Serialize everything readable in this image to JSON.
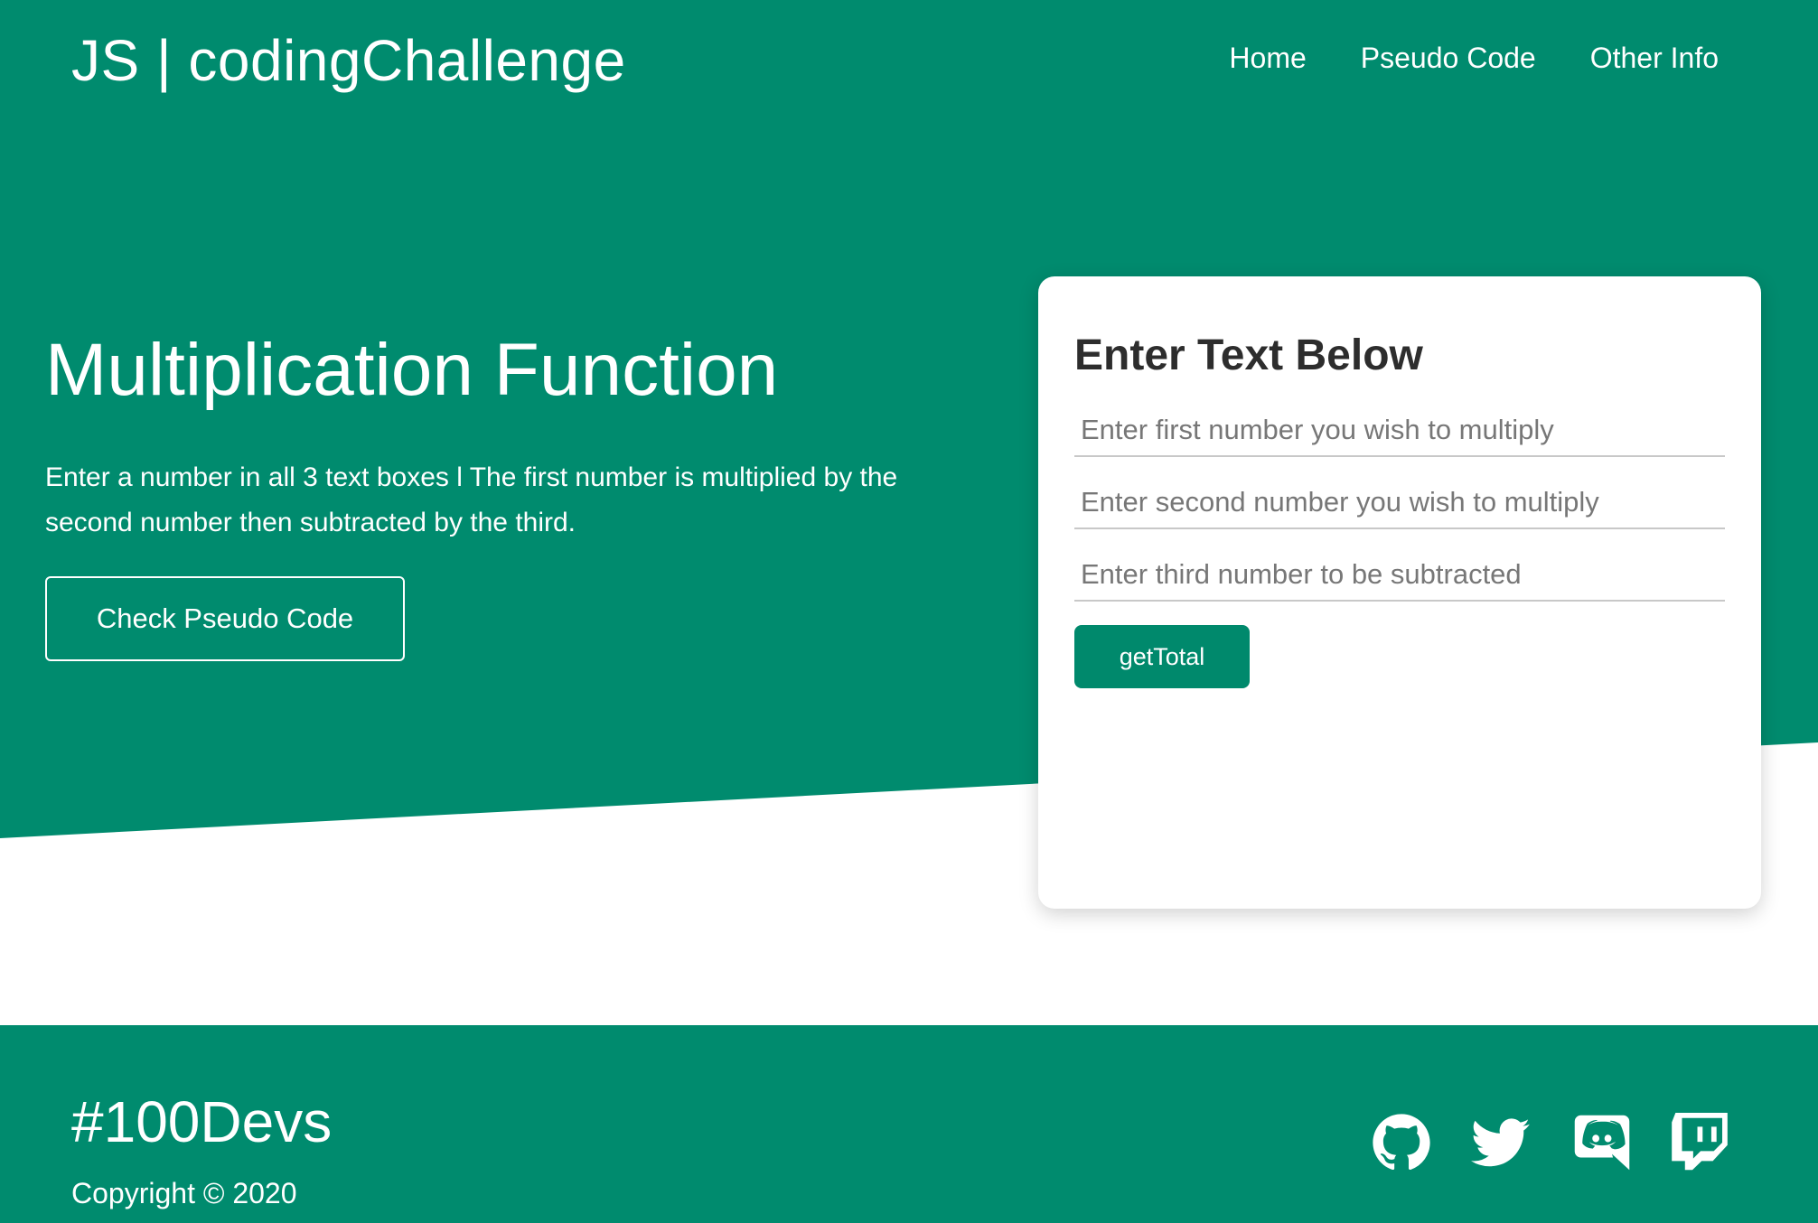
{
  "colors": {
    "primary": "#008b6e",
    "card": "#ffffff",
    "input_border": "#c8c8c8",
    "placeholder": "#777777"
  },
  "nav": {
    "brand": "JS | codingChallenge",
    "links": [
      {
        "label": "Home"
      },
      {
        "label": "Pseudo Code"
      },
      {
        "label": "Other Info"
      }
    ]
  },
  "hero": {
    "title": "Multiplication Function",
    "description": "Enter a number in all 3 text boxes l The first number is multiplied by the second number then subtracted by the third.",
    "cta_label": "Check Pseudo Code"
  },
  "form": {
    "title": "Enter Text Below",
    "fields": [
      {
        "placeholder": "Enter first number you wish to multiply",
        "value": ""
      },
      {
        "placeholder": "Enter second number you wish to multiply",
        "value": ""
      },
      {
        "placeholder": "Enter third number to be subtracted",
        "value": ""
      }
    ],
    "button_label": "getTotal"
  },
  "footer": {
    "title": "#100Devs",
    "copyright": "Copyright © 2020",
    "social_icons": [
      "github-icon",
      "twitter-icon",
      "discord-icon",
      "twitch-icon"
    ]
  }
}
